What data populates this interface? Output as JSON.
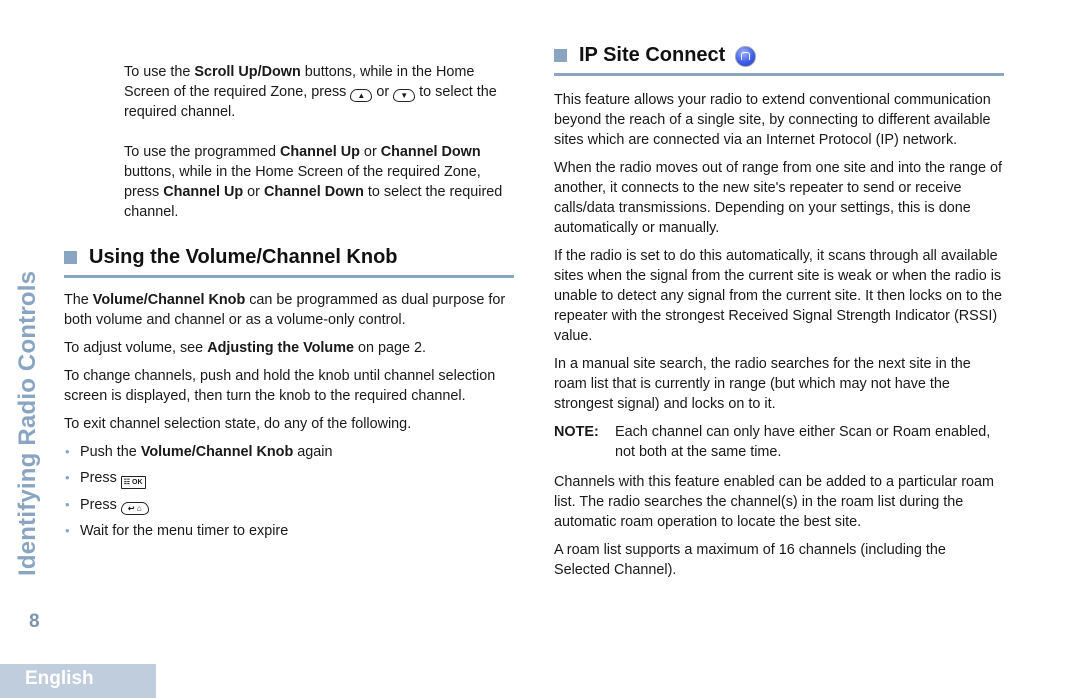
{
  "sidebar": {
    "chapter_title": "Identifying Radio Controls",
    "page_number": "8",
    "language_tab": "English"
  },
  "left": {
    "scroll_para": {
      "t1": "To use the ",
      "b1": "Scroll Up/Down",
      "t2": " buttons, while in the Home Screen of the required Zone, press ",
      "t3": " or ",
      "t4": " to select the required channel."
    },
    "channel_para": {
      "t1": "To use the programmed ",
      "b1": "Channel Up",
      "t2": " or ",
      "b2": "Channel Down",
      "t3": " buttons, while in the Home Screen of the required Zone, press ",
      "b3": "Channel Up",
      "t4": " or ",
      "b4": "Channel Down",
      "t5": " to select the required channel."
    },
    "section": {
      "title": "Using the Volume/Channel Knob",
      "p1": {
        "t1": "The ",
        "b1": "Volume/Channel Knob",
        "t2": " can be programmed as dual purpose for both volume and channel or as a volume-only control."
      },
      "p2": {
        "t1": "To adjust volume, see ",
        "b1": "Adjusting the Volume",
        "t2": " on page 2."
      },
      "p3": "To change channels, push and hold the knob until channel selection screen is displayed, then turn the knob to the required channel.",
      "p4": "To exit channel selection state, do any of the following.",
      "bullets": [
        {
          "t1": "Push the ",
          "b1": "Volume/Channel Knob",
          "t2": " again"
        },
        {
          "t1": "Press "
        },
        {
          "t1": "Press "
        },
        {
          "t1": "Wait for the menu timer to expire"
        }
      ],
      "bullet_glyph": "•"
    },
    "icons": {
      "scroll_up": "▲",
      "scroll_down": "▼",
      "menu_ok": "☷ OK",
      "back_home": "↩ ⌂"
    }
  },
  "right": {
    "section": {
      "title": "IP Site Connect",
      "paragraphs": [
        "This feature allows your radio to extend conventional communication beyond the reach of a single site, by connecting to different available sites which are connected via an Internet Protocol (IP) network.",
        "When the radio moves out of range from one site and into the range of another, it connects to the new site's repeater to send or receive calls/data transmissions. Depending on your settings, this is done automatically or manually.",
        "If the radio is set to do this automatically, it scans through all available sites when the signal from the current site is weak or when the radio is unable to detect any signal from the current site. It then locks on to the repeater with the strongest Received Signal Strength Indicator (RSSI) value.",
        "In a manual site search, the radio searches for the next site in the roam list that is currently in range (but which may not have the strongest signal) and locks on to it."
      ],
      "note": {
        "label": "NOTE:",
        "text": "Each channel can only have either Scan or Roam enabled, not both at the same time."
      },
      "paragraphs_after": [
        "Channels with this feature enabled can be added to a particular roam list. The radio searches the channel(s) in the roam list during the automatic roam operation to locate the best site.",
        "A roam list supports a maximum of 16 channels (including the Selected Channel)."
      ]
    }
  },
  "colors": {
    "accent": "#8aa5c2",
    "language_tab_bg": "#c0cddc",
    "page_number": "#7f93ab"
  }
}
